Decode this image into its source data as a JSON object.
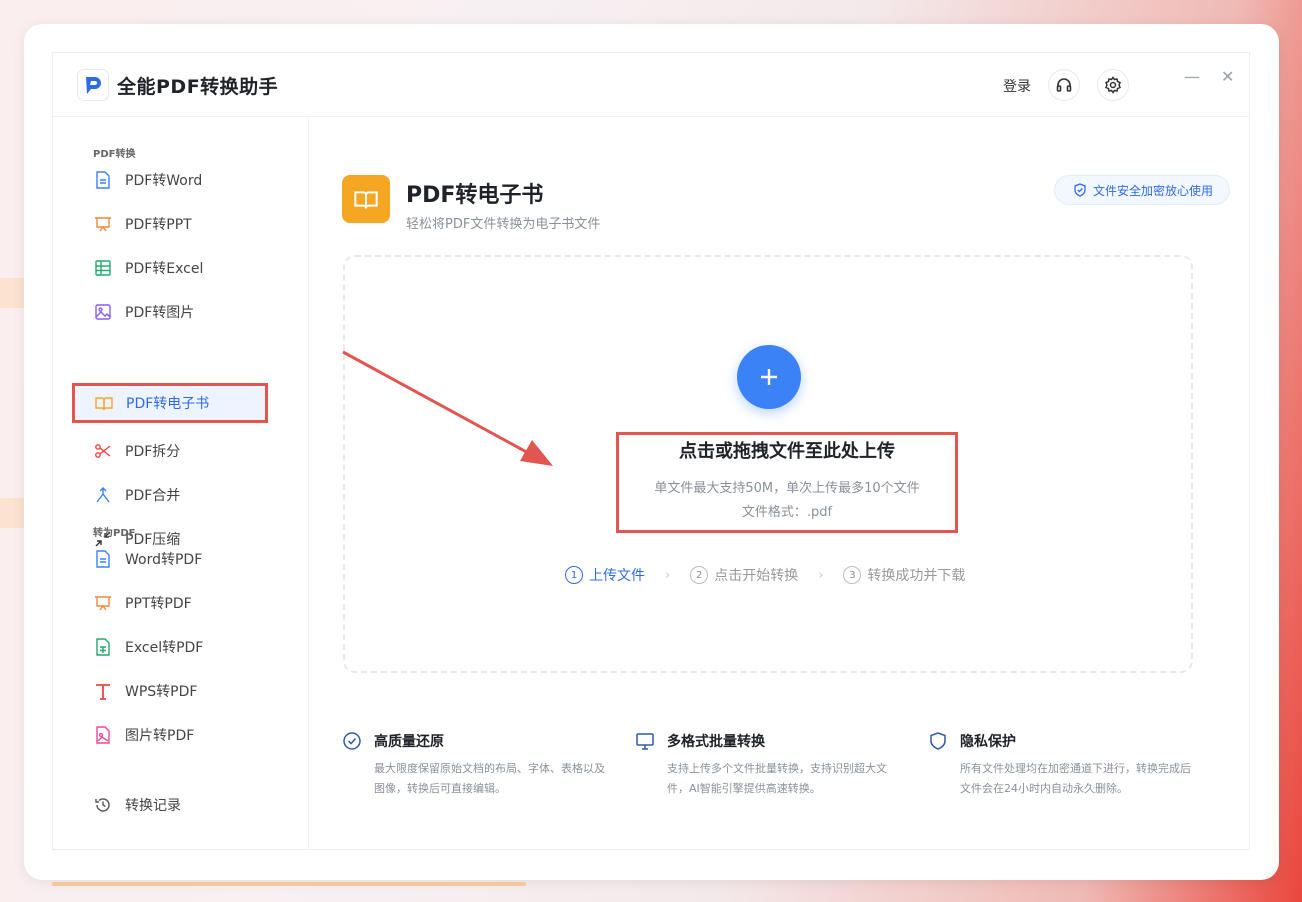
{
  "app": {
    "title": "全能PDF转换助手",
    "login": "登录"
  },
  "sidebar": {
    "section1": "PDF转换",
    "items1": [
      {
        "label": "PDF转Word",
        "icon": "word-doc-icon",
        "color": "#3b82f6"
      },
      {
        "label": "PDF转PPT",
        "icon": "presentation-icon",
        "color": "#f08a3a"
      },
      {
        "label": "PDF转Excel",
        "icon": "table-icon",
        "color": "#22a96b"
      },
      {
        "label": "PDF转图片",
        "icon": "image-icon",
        "color": "#8b5cf6"
      },
      {
        "label": "PDF转电子书",
        "icon": "book-icon",
        "color": "#f5a623",
        "active": true
      },
      {
        "label": "PDF拆分",
        "icon": "scissors-icon",
        "color": "#ef4444"
      },
      {
        "label": "PDF合并",
        "icon": "merge-icon",
        "color": "#3b82f6"
      },
      {
        "label": "PDF压缩",
        "icon": "compress-icon",
        "color": "#333333"
      }
    ],
    "section2": "转为PDF",
    "items2": [
      {
        "label": "Word转PDF",
        "icon": "word-doc-icon",
        "color": "#3b82f6"
      },
      {
        "label": "PPT转PDF",
        "icon": "presentation-icon",
        "color": "#f08a3a"
      },
      {
        "label": "Excel转PDF",
        "icon": "excel-doc-icon",
        "color": "#22a96b"
      },
      {
        "label": "WPS转PDF",
        "icon": "wps-icon",
        "color": "#ef4444"
      },
      {
        "label": "图片转PDF",
        "icon": "image-doc-icon",
        "color": "#ec4899"
      }
    ],
    "history": "转换记录"
  },
  "main": {
    "title": "PDF转电子书",
    "subtitle": "轻松将PDF文件转换为电子书文件",
    "badge": "文件安全加密放心使用",
    "upload": {
      "title": "点击或拖拽文件至此处上传",
      "line1": "单文件最大支持50M，单次上传最多10个文件",
      "line2": "文件格式：.pdf"
    },
    "steps": [
      {
        "num": "1",
        "label": "上传文件"
      },
      {
        "num": "2",
        "label": "点击开始转换"
      },
      {
        "num": "3",
        "label": "转换成功并下载"
      }
    ],
    "features": [
      {
        "title": "高质量还原",
        "desc": "最大限度保留原始文档的布局、字体、表格以及图像，转换后可直接编辑。"
      },
      {
        "title": "多格式批量转换",
        "desc": "支持上传多个文件批量转换，支持识别超大文件，AI智能引擎提供高速转换。"
      },
      {
        "title": "隐私保护",
        "desc": "所有文件处理均在加密通道下进行，转换完成后文件会在24小时内自动永久删除。"
      }
    ]
  },
  "colors": {
    "accent": "#3b82f6",
    "highlight": "#e25550",
    "ebook": "#f5a623"
  }
}
